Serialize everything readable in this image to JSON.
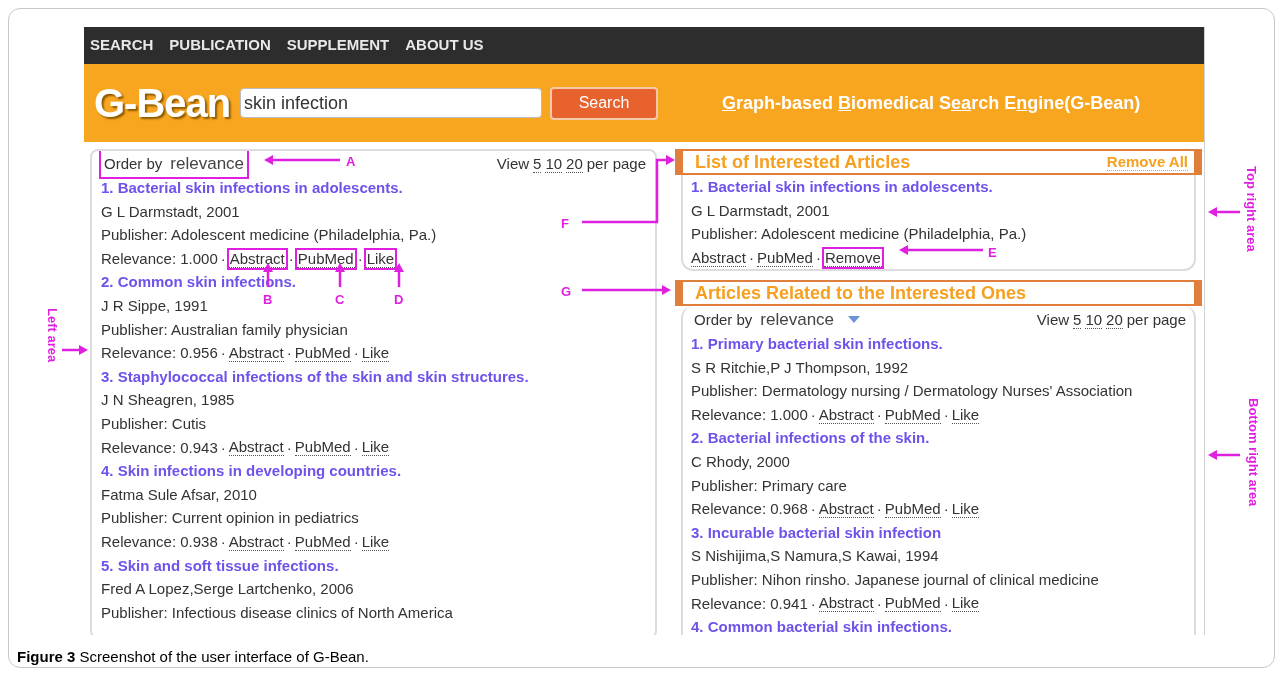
{
  "nav": [
    "SEARCH",
    "PUBLICATION",
    "SUPPLEMENT",
    "ABOUT US"
  ],
  "logo": "G-Bean",
  "search": {
    "value": "skin infection",
    "button": "Search"
  },
  "tagline": [
    {
      "text": "G",
      "underline": true
    },
    {
      "text": "raph-based ",
      "underline": false
    },
    {
      "text": "B",
      "underline": true
    },
    {
      "text": "iomedical S",
      "underline": false
    },
    {
      "text": "ea",
      "underline": true
    },
    {
      "text": "rch E",
      "underline": false
    },
    {
      "text": "n",
      "underline": true
    },
    {
      "text": "gine(G-Bean)",
      "underline": false
    }
  ],
  "separator": "·",
  "results": {
    "order_label": "Order by",
    "order_value": "relevance",
    "highlighted": true,
    "view_label": "View",
    "view_options": [
      "5",
      "10",
      "20"
    ],
    "view_suffix": "per page",
    "articles": [
      {
        "title": "1. Bacterial skin infections in adolescents.",
        "authors": "G L Darmstadt, 2001",
        "publisher": "Publisher: Adolescent medicine (Philadelphia, Pa.)",
        "relevance": "Relevance: 1.000",
        "links": [
          {
            "label": "Abstract",
            "highlighted": true
          },
          {
            "label": "PubMed",
            "highlighted": true
          },
          {
            "label": "Like",
            "highlighted": true
          }
        ]
      },
      {
        "title": "2. Common skin infections.",
        "authors": "J R Sippe, 1991",
        "publisher": "Publisher: Australian family physician",
        "relevance": "Relevance: 0.956",
        "links": [
          {
            "label": "Abstract",
            "highlighted": false
          },
          {
            "label": "PubMed",
            "highlighted": false
          },
          {
            "label": "Like",
            "highlighted": false
          }
        ]
      },
      {
        "title": "3. Staphylococcal infections of the skin and skin structures.",
        "authors": "J N Sheagren, 1985",
        "publisher": "Publisher: Cutis",
        "relevance": "Relevance: 0.943",
        "links": [
          {
            "label": "Abstract",
            "highlighted": false
          },
          {
            "label": "PubMed",
            "highlighted": false
          },
          {
            "label": "Like",
            "highlighted": false
          }
        ]
      },
      {
        "title": "4. Skin infections in developing countries.",
        "authors": "Fatma Sule Afsar, 2010",
        "publisher": "Publisher: Current opinion in pediatrics",
        "relevance": "Relevance: 0.938",
        "links": [
          {
            "label": "Abstract",
            "highlighted": false
          },
          {
            "label": "PubMed",
            "highlighted": false
          },
          {
            "label": "Like",
            "highlighted": false
          }
        ]
      },
      {
        "title": "5. Skin and soft tissue infections.",
        "authors": "Fred A Lopez,Serge Lartchenko, 2006",
        "publisher": "Publisher: Infectious disease clinics of North America"
      }
    ]
  },
  "interested": {
    "title": "List of Interested Articles",
    "remove_all": "Remove All",
    "articles": [
      {
        "title": "1. Bacterial skin infections in adolescents.",
        "authors": "G L Darmstadt, 2001",
        "publisher": "Publisher: Adolescent medicine (Philadelphia, Pa.)",
        "links": [
          {
            "label": "Abstract",
            "highlighted": false
          },
          {
            "label": "PubMed",
            "highlighted": false
          },
          {
            "label": "Remove",
            "highlighted": true
          }
        ]
      }
    ]
  },
  "related": {
    "title": "Articles Related to the Interested Ones",
    "order_label": "Order by",
    "order_value": "relevance",
    "highlighted": false,
    "view_label": "View",
    "view_options": [
      "5",
      "10",
      "20"
    ],
    "view_suffix": "per page",
    "articles": [
      {
        "title": "1. Primary bacterial skin infections.",
        "authors": "S R Ritchie,P J Thompson, 1992",
        "publisher": "Publisher: Dermatology nursing / Dermatology Nurses' Association",
        "relevance": "Relevance: 1.000",
        "links": [
          {
            "label": "Abstract",
            "highlighted": false
          },
          {
            "label": "PubMed",
            "highlighted": false
          },
          {
            "label": "Like",
            "highlighted": false
          }
        ]
      },
      {
        "title": "2. Bacterial infections of the skin.",
        "authors": "C Rhody, 2000",
        "publisher": "Publisher: Primary care",
        "relevance": "Relevance: 0.968",
        "links": [
          {
            "label": "Abstract",
            "highlighted": false
          },
          {
            "label": "PubMed",
            "highlighted": false
          },
          {
            "label": "Like",
            "highlighted": false
          }
        ]
      },
      {
        "title": "3. Incurable bacterial skin infection",
        "authors": "S Nishijima,S Namura,S Kawai, 1994",
        "publisher": "Publisher: Nihon rinsho. Japanese journal of clinical medicine",
        "relevance": "Relevance: 0.941",
        "links": [
          {
            "label": "Abstract",
            "highlighted": false
          },
          {
            "label": "PubMed",
            "highlighted": false
          },
          {
            "label": "Like",
            "highlighted": false
          }
        ]
      },
      {
        "title": "4. Common bacterial skin infections."
      }
    ]
  },
  "annotations": [
    "A",
    "B",
    "C",
    "D",
    "E",
    "F",
    "G"
  ],
  "area_labels": [
    "Left area",
    "Top right area",
    "Bottom right area"
  ],
  "caption": "**Figure 3** Screenshot of the user interface of G-Bean."
}
